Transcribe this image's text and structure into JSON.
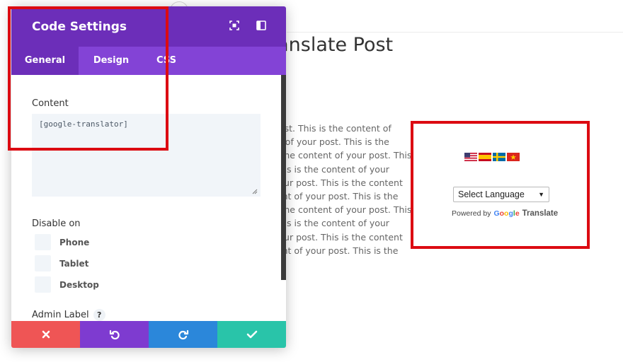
{
  "page": {
    "title": "ranslate Post",
    "body_lines": [
      "post. This is the content of",
      "nt of your post. This is the",
      "s the content of your post. This",
      "This is the content of your",
      "your post. This is the content",
      "tent of your post. This is the",
      "s the content of your post. This",
      "This is the content of your",
      "your post. This is the content",
      "tent of your post. This is the"
    ]
  },
  "translator_widget": {
    "flags": [
      "us-flag",
      "spain-flag",
      "sweden-flag",
      "vietnam-flag"
    ],
    "select_value": "Select Language",
    "powered_by": "Powered by",
    "google": "Google",
    "translate": "Translate"
  },
  "modal": {
    "title": "Code Settings",
    "tabs": [
      {
        "label": "General",
        "active": true
      },
      {
        "label": "Design",
        "active": false
      },
      {
        "label": "CSS",
        "active": false
      }
    ],
    "content_label": "Content",
    "content_value": "[google-translator]",
    "disable_on_label": "Disable on",
    "disable_options": [
      "Phone",
      "Tablet",
      "Desktop"
    ],
    "admin_label": "Admin Label",
    "help": "?",
    "footer_buttons": [
      {
        "name": "discard",
        "color": "#ef5555"
      },
      {
        "name": "undo",
        "color": "#7e3bd0"
      },
      {
        "name": "redo",
        "color": "#2b87da"
      },
      {
        "name": "save",
        "color": "#29c4a9"
      }
    ]
  },
  "colors": {
    "header": "#6c2eb9",
    "tabs": "#8343d6",
    "highlight": "#dc0b12"
  }
}
